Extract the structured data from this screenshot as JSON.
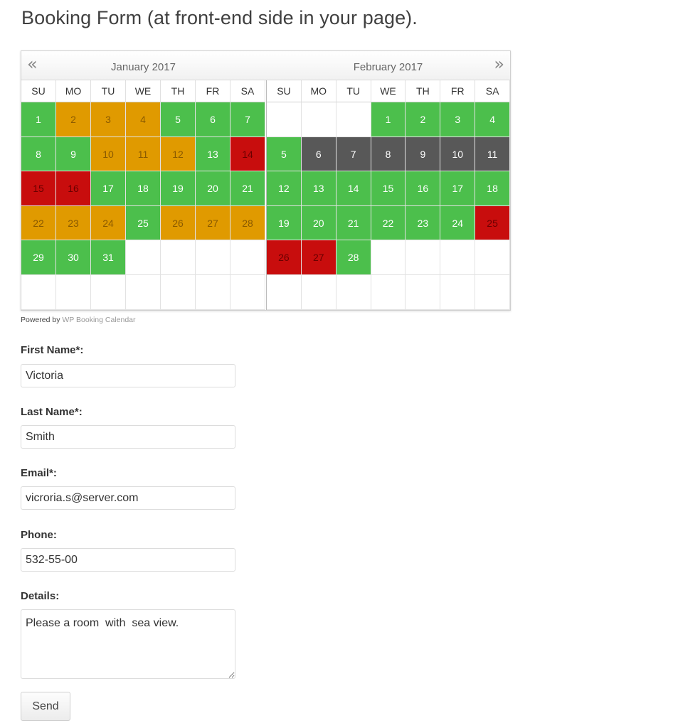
{
  "page": {
    "title": "Booking Form (at front-end side in your page)."
  },
  "calendar": {
    "prev_label": "«",
    "next_label": "»",
    "weekdays": [
      "SU",
      "MO",
      "TU",
      "WE",
      "TH",
      "FR",
      "SA"
    ],
    "colors": {
      "available": "#4cbf4c",
      "pending": "#e09a00",
      "booked": "#c80d0d",
      "past": "#585858"
    },
    "months": [
      {
        "title": "January 2017",
        "weeks": [
          [
            [
              "1",
              "available"
            ],
            [
              "2",
              "pending"
            ],
            [
              "3",
              "pending"
            ],
            [
              "4",
              "pending"
            ],
            [
              "5",
              "available"
            ],
            [
              "6",
              "available"
            ],
            [
              "7",
              "available"
            ]
          ],
          [
            [
              "8",
              "available"
            ],
            [
              "9",
              "available"
            ],
            [
              "10",
              "pending"
            ],
            [
              "11",
              "pending"
            ],
            [
              "12",
              "pending"
            ],
            [
              "13",
              "available"
            ],
            [
              "14",
              "booked"
            ]
          ],
          [
            [
              "15",
              "booked"
            ],
            [
              "16",
              "booked"
            ],
            [
              "17",
              "available"
            ],
            [
              "18",
              "available"
            ],
            [
              "19",
              "available"
            ],
            [
              "20",
              "available"
            ],
            [
              "21",
              "available"
            ]
          ],
          [
            [
              "22",
              "pending"
            ],
            [
              "23",
              "pending"
            ],
            [
              "24",
              "pending"
            ],
            [
              "25",
              "available"
            ],
            [
              "26",
              "pending"
            ],
            [
              "27",
              "pending"
            ],
            [
              "28",
              "pending"
            ]
          ],
          [
            [
              "29",
              "available"
            ],
            [
              "30",
              "available"
            ],
            [
              "31",
              "available"
            ],
            [
              "",
              "empty"
            ],
            [
              "",
              "empty"
            ],
            [
              "",
              "empty"
            ],
            [
              "",
              "empty"
            ]
          ],
          [
            [
              "",
              "empty"
            ],
            [
              "",
              "empty"
            ],
            [
              "",
              "empty"
            ],
            [
              "",
              "empty"
            ],
            [
              "",
              "empty"
            ],
            [
              "",
              "empty"
            ],
            [
              "",
              "empty"
            ]
          ]
        ]
      },
      {
        "title": "February 2017",
        "weeks": [
          [
            [
              "",
              "empty"
            ],
            [
              "",
              "empty"
            ],
            [
              "",
              "empty"
            ],
            [
              "1",
              "available"
            ],
            [
              "2",
              "available"
            ],
            [
              "3",
              "available"
            ],
            [
              "4",
              "available"
            ]
          ],
          [
            [
              "5",
              "available"
            ],
            [
              "6",
              "past"
            ],
            [
              "7",
              "past"
            ],
            [
              "8",
              "past"
            ],
            [
              "9",
              "past"
            ],
            [
              "10",
              "past"
            ],
            [
              "11",
              "past"
            ]
          ],
          [
            [
              "12",
              "available"
            ],
            [
              "13",
              "available"
            ],
            [
              "14",
              "available"
            ],
            [
              "15",
              "available"
            ],
            [
              "16",
              "available"
            ],
            [
              "17",
              "available"
            ],
            [
              "18",
              "available"
            ]
          ],
          [
            [
              "19",
              "available"
            ],
            [
              "20",
              "available"
            ],
            [
              "21",
              "available"
            ],
            [
              "22",
              "available"
            ],
            [
              "23",
              "available"
            ],
            [
              "24",
              "available"
            ],
            [
              "25",
              "booked"
            ]
          ],
          [
            [
              "26",
              "booked"
            ],
            [
              "27",
              "booked"
            ],
            [
              "28",
              "available"
            ],
            [
              "",
              "empty"
            ],
            [
              "",
              "empty"
            ],
            [
              "",
              "empty"
            ],
            [
              "",
              "empty"
            ]
          ],
          [
            [
              "",
              "empty"
            ],
            [
              "",
              "empty"
            ],
            [
              "",
              "empty"
            ],
            [
              "",
              "empty"
            ],
            [
              "",
              "empty"
            ],
            [
              "",
              "empty"
            ],
            [
              "",
              "empty"
            ]
          ]
        ]
      }
    ]
  },
  "powered": {
    "prefix": "Powered by",
    "link": "WP Booking Calendar"
  },
  "form": {
    "first_name": {
      "label": "First Name*:",
      "value": "Victoria"
    },
    "last_name": {
      "label": "Last Name*:",
      "value": "Smith"
    },
    "email": {
      "label": "Email*:",
      "value": "vicroria.s@server.com"
    },
    "phone": {
      "label": "Phone:",
      "value": "532-55-00"
    },
    "details": {
      "label": "Details:",
      "value": "Please a room  with  sea view."
    },
    "send_label": "Send"
  }
}
